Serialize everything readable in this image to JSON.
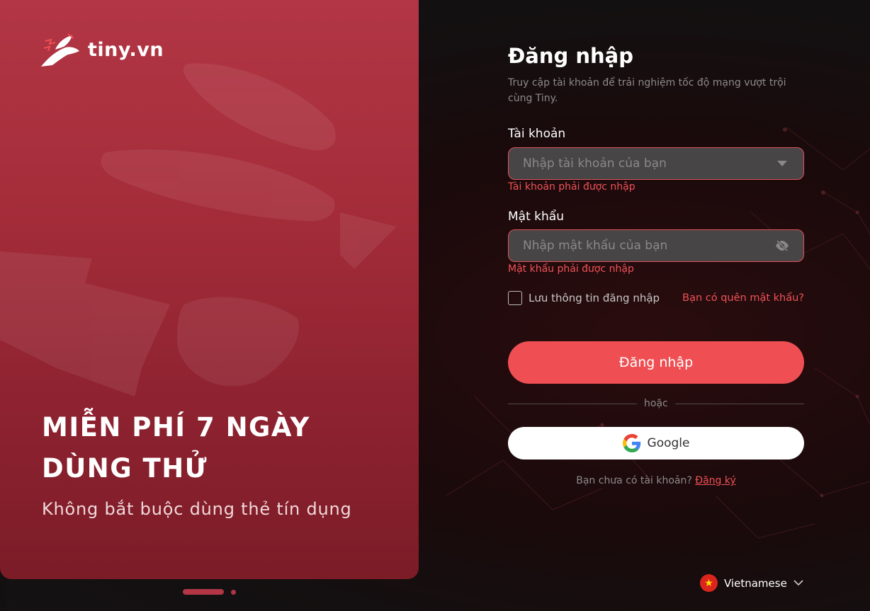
{
  "brand": {
    "logo_text": "tiny.vn"
  },
  "promo": {
    "headline_line1": "MIỄN PHÍ 7 NGÀY",
    "headline_line2": "DÙNG THỬ",
    "subline": "Không bắt buộc dùng thẻ tín dụng",
    "slides_count": 2,
    "active_slide": 1
  },
  "login": {
    "title": "Đăng nhập",
    "description": "Truy cập tài khoản để trải nghiệm tốc độ mạng vượt trội cùng Tiny.",
    "account": {
      "label": "Tài khoản",
      "placeholder": "Nhập tài khoản của bạn",
      "error": "Tài khoản phải được nhập",
      "icon": "caret-down-icon"
    },
    "password": {
      "label": "Mật khẩu",
      "placeholder": "Nhập mật khẩu của bạn",
      "error": "Mật khẩu phải được nhập",
      "icon": "eye-off-icon"
    },
    "remember_label": "Lưu thông tin đăng nhập",
    "remember_checked": false,
    "forgot_label": "Bạn có quên mật khẩu?",
    "submit_label": "Đăng nhập",
    "or_label": "hoặc",
    "google_label": "Google",
    "signup_prompt": "Bạn chưa có tài khoản?",
    "signup_link": "Đăng ký"
  },
  "language": {
    "label": "Vietnamese",
    "flag": "vietnam-flag-icon"
  },
  "colors": {
    "accent": "#ef4f53",
    "promo_top": "#b23645",
    "promo_bottom": "#7b1c27",
    "background": "#131011",
    "input_bg": "#474546"
  }
}
